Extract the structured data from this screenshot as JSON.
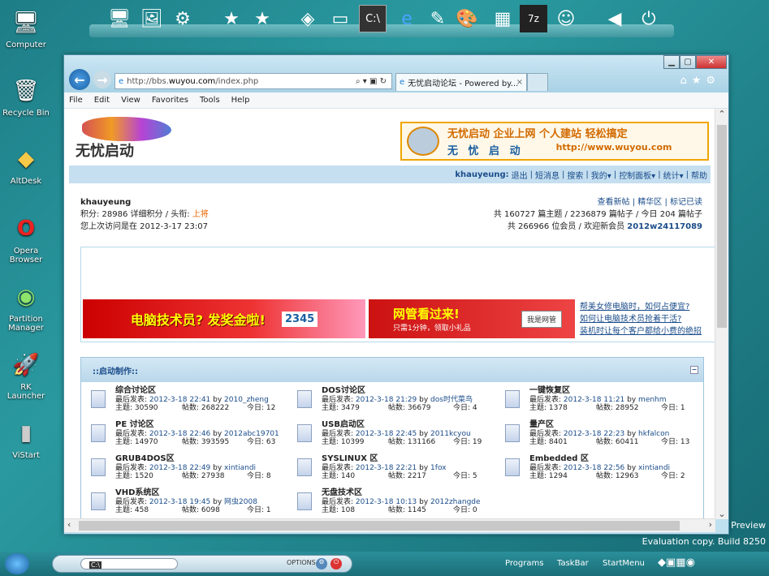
{
  "desktop": {
    "icons": [
      {
        "label": "Computer",
        "icon": "computer-icon",
        "glyph": "🖥"
      },
      {
        "label": "Recycle Bin",
        "icon": "recycle-bin-icon",
        "glyph": "🗑"
      },
      {
        "label": "AltDesk",
        "icon": "altdesk-icon",
        "glyph": "◆"
      },
      {
        "label": "Opera Browser",
        "icon": "opera-icon",
        "glyph": "O"
      },
      {
        "label": "Partition Manager",
        "icon": "partition-manager-icon",
        "glyph": "◉"
      },
      {
        "label": "RK Launcher",
        "icon": "rk-launcher-icon",
        "glyph": "🚀"
      },
      {
        "label": "ViStart",
        "icon": "vistart-icon",
        "glyph": "▮"
      }
    ]
  },
  "window": {
    "address_prefix": "http://bbs.",
    "address_domain": "wuyou.com",
    "address_suffix": "/index.php",
    "tab_title": "无忧启动论坛 - Powered by...",
    "menu": [
      "File",
      "Edit",
      "View",
      "Favorites",
      "Tools",
      "Help"
    ]
  },
  "page": {
    "logo_text": "无忧启动",
    "banner_text": "无忧启动  企业上网  个人建站  轻松搞定",
    "banner_sub": "无 忧 启 动",
    "banner_url": "http://www.wuyou.com",
    "userbar": {
      "username": "khauyeung:",
      "links": [
        "退出",
        "短消息",
        "搜索",
        "我的▾",
        "控制面板▾",
        "统计▾",
        "帮助"
      ]
    },
    "user": {
      "name": "khauyeung",
      "points": "积分: 28986 详细积分 / 头衔: ",
      "title": "上将",
      "last_visit": "您上次访问是在 2012-3-17 23:07"
    },
    "stats": {
      "links": "查看新帖 | 精华区 | 标记已读",
      "line1": "共 160727 篇主题 / 2236879 篇帖子 / 今日 204 篇帖子",
      "line2_prefix": "共 266966 位会员 / 欢迎新会员 ",
      "new_member": "2012w24117089"
    },
    "ads": {
      "ad1": "电脑技术员? 发奖金啦!",
      "ad1_logo": "2345",
      "ad2": "网管看过来!",
      "ad2_sub": "只需1分钟，领取小礼品",
      "ad2_btn": "我是网管",
      "links": [
        "帮美女修电脑时，如何占便宜?",
        "如何让电脑技术员抢着干活?",
        "装机时让每个客户都给小费的绝招"
      ]
    },
    "forum": {
      "section_title": "::启动制作::",
      "boards": [
        {
          "name": "综合讨论区",
          "last_label": "最后发表: ",
          "last_time": "2012-3-18 22:41",
          "by": " by ",
          "user": "2010_zheng",
          "topics": "主题: 30590",
          "posts": "帖数: 268222",
          "today": "今日: 12"
        },
        {
          "name": "DOS讨论区",
          "last_label": "最后发表: ",
          "last_time": "2012-3-18 21:29",
          "by": " by ",
          "user": "dos时代菜鸟",
          "topics": "主题: 3479",
          "posts": "帖数: 36679",
          "today": "今日: 4"
        },
        {
          "name": "一键恢复区",
          "last_label": "最后发表: ",
          "last_time": "2012-3-18 11:21",
          "by": " by ",
          "user": "menhm",
          "topics": "主题: 1378",
          "posts": "帖数: 28952",
          "today": "今日: 1"
        },
        {
          "name": "PE 讨论区",
          "last_label": "最后发表: ",
          "last_time": "2012-3-18 22:46",
          "by": " by ",
          "user": "2012abc19701",
          "topics": "主题: 14970",
          "posts": "帖数: 393595",
          "today": "今日: 63"
        },
        {
          "name": "USB启动区",
          "last_label": "最后发表: ",
          "last_time": "2012-3-18 22:45",
          "by": " by ",
          "user": "2011kcyou",
          "topics": "主题: 10399",
          "posts": "帖数: 131166",
          "today": "今日: 19"
        },
        {
          "name": "量产区",
          "last_label": "最后发表: ",
          "last_time": "2012-3-18 22:23",
          "by": " by ",
          "user": "hkfalcon",
          "topics": "主题: 8401",
          "posts": "帖数: 60411",
          "today": "今日: 13"
        },
        {
          "name": "GRUB4DOS区",
          "last_label": "最后发表: ",
          "last_time": "2012-3-18 22:49",
          "by": " by ",
          "user": "xintiandi",
          "topics": "主题: 1520",
          "posts": "帖数: 27938",
          "today": "今日: 8"
        },
        {
          "name": "SYSLINUX 区",
          "last_label": "最后发表: ",
          "last_time": "2012-3-18 22:21",
          "by": " by ",
          "user": "1fox",
          "topics": "主题: 140",
          "posts": "帖数: 2217",
          "today": "今日: 5"
        },
        {
          "name": "Embedded 区",
          "last_label": "最后发表: ",
          "last_time": "2012-3-18 22:56",
          "by": " by ",
          "user": "xintiandi",
          "topics": "主题: 1294",
          "posts": "帖数: 12963",
          "today": "今日: 2"
        },
        {
          "name": "VHD系统区",
          "last_label": "最后发表: ",
          "last_time": "2012-3-18 19:45",
          "by": " by ",
          "user": "网虫2008",
          "topics": "主题: 458",
          "posts": "帖数: 6098",
          "today": "今日: 1"
        },
        {
          "name": "无盘技术区",
          "last_label": "最后发表: ",
          "last_time": "2012-3-18 10:13",
          "by": " by ",
          "user": "2012zhangde",
          "topics": "主题: 108",
          "posts": "帖数: 1145",
          "today": "今日: 0"
        }
      ]
    }
  },
  "taskbar": {
    "options": "OPTIONS",
    "programs": "Programs",
    "taskbar": "TaskBar",
    "startmenu": "StartMenu"
  },
  "watermark": {
    "line1": "Preview",
    "line2": "Evaluation copy. Build 8250"
  }
}
